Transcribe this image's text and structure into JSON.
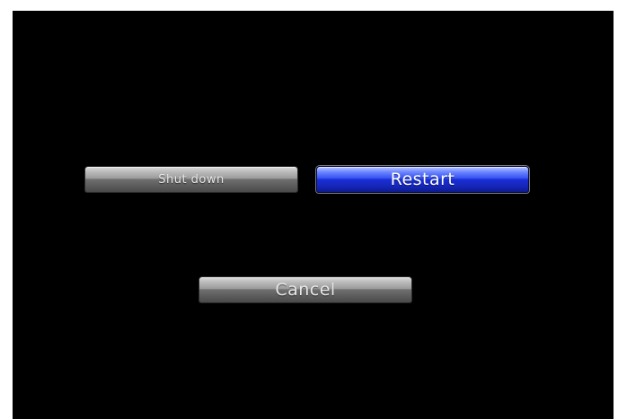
{
  "dialog": {
    "buttons": {
      "shut_down": "Shut down",
      "restart": "Restart",
      "cancel": "Cancel"
    },
    "focused_button": "restart"
  },
  "colors": {
    "background": "#000000",
    "focused_button": "#1a2fd6",
    "default_button": "#6f6f6f"
  }
}
